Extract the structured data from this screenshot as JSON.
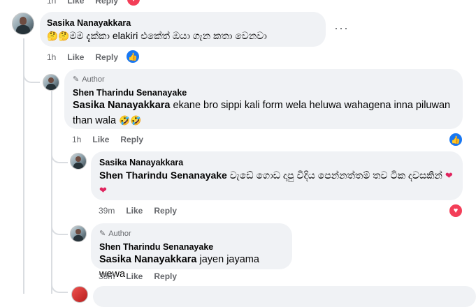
{
  "top_meta": {
    "time": "1h",
    "like": "Like",
    "reply": "Reply"
  },
  "c1": {
    "name": "Sasika Nanayakkara",
    "emoji": "🤔🤔",
    "text": "මම දැක්කා elakiri එකේත් ඔයා ගැන කතා වෙනවා",
    "time": "1h",
    "like": "Like",
    "reply": "Reply",
    "more": "···"
  },
  "c2": {
    "author_badge": "Author",
    "name": "Shen Tharindu Senanayake",
    "mention": "Sasika Nanayakkara",
    "text": " ekane bro sippi kali form wela heluwa wahagena inna piluwan than wala ",
    "emoji": "🤣🤣",
    "time": "1h",
    "like": "Like",
    "reply": "Reply"
  },
  "c3": {
    "name": "Sasika Nanayakkara",
    "mention": "Shen Tharindu Senanayake",
    "text": " වැඩේ ගොඩ දාපු විදිය පෙන්නත්තම් තව ටික දවසකින් ",
    "emoji": "❤❤",
    "time": "39m",
    "like": "Like",
    "reply": "Reply"
  },
  "c4": {
    "author_badge": "Author",
    "name": "Shen Tharindu Senanayake",
    "mention": "Sasika Nanayakkara",
    "text": " jayen jayama wewa",
    "time": "38m",
    "like": "Like",
    "reply": "Reply"
  },
  "colors": {
    "like": "#1877f2",
    "love": "#f33e58",
    "bubble": "#f0f2f5"
  }
}
